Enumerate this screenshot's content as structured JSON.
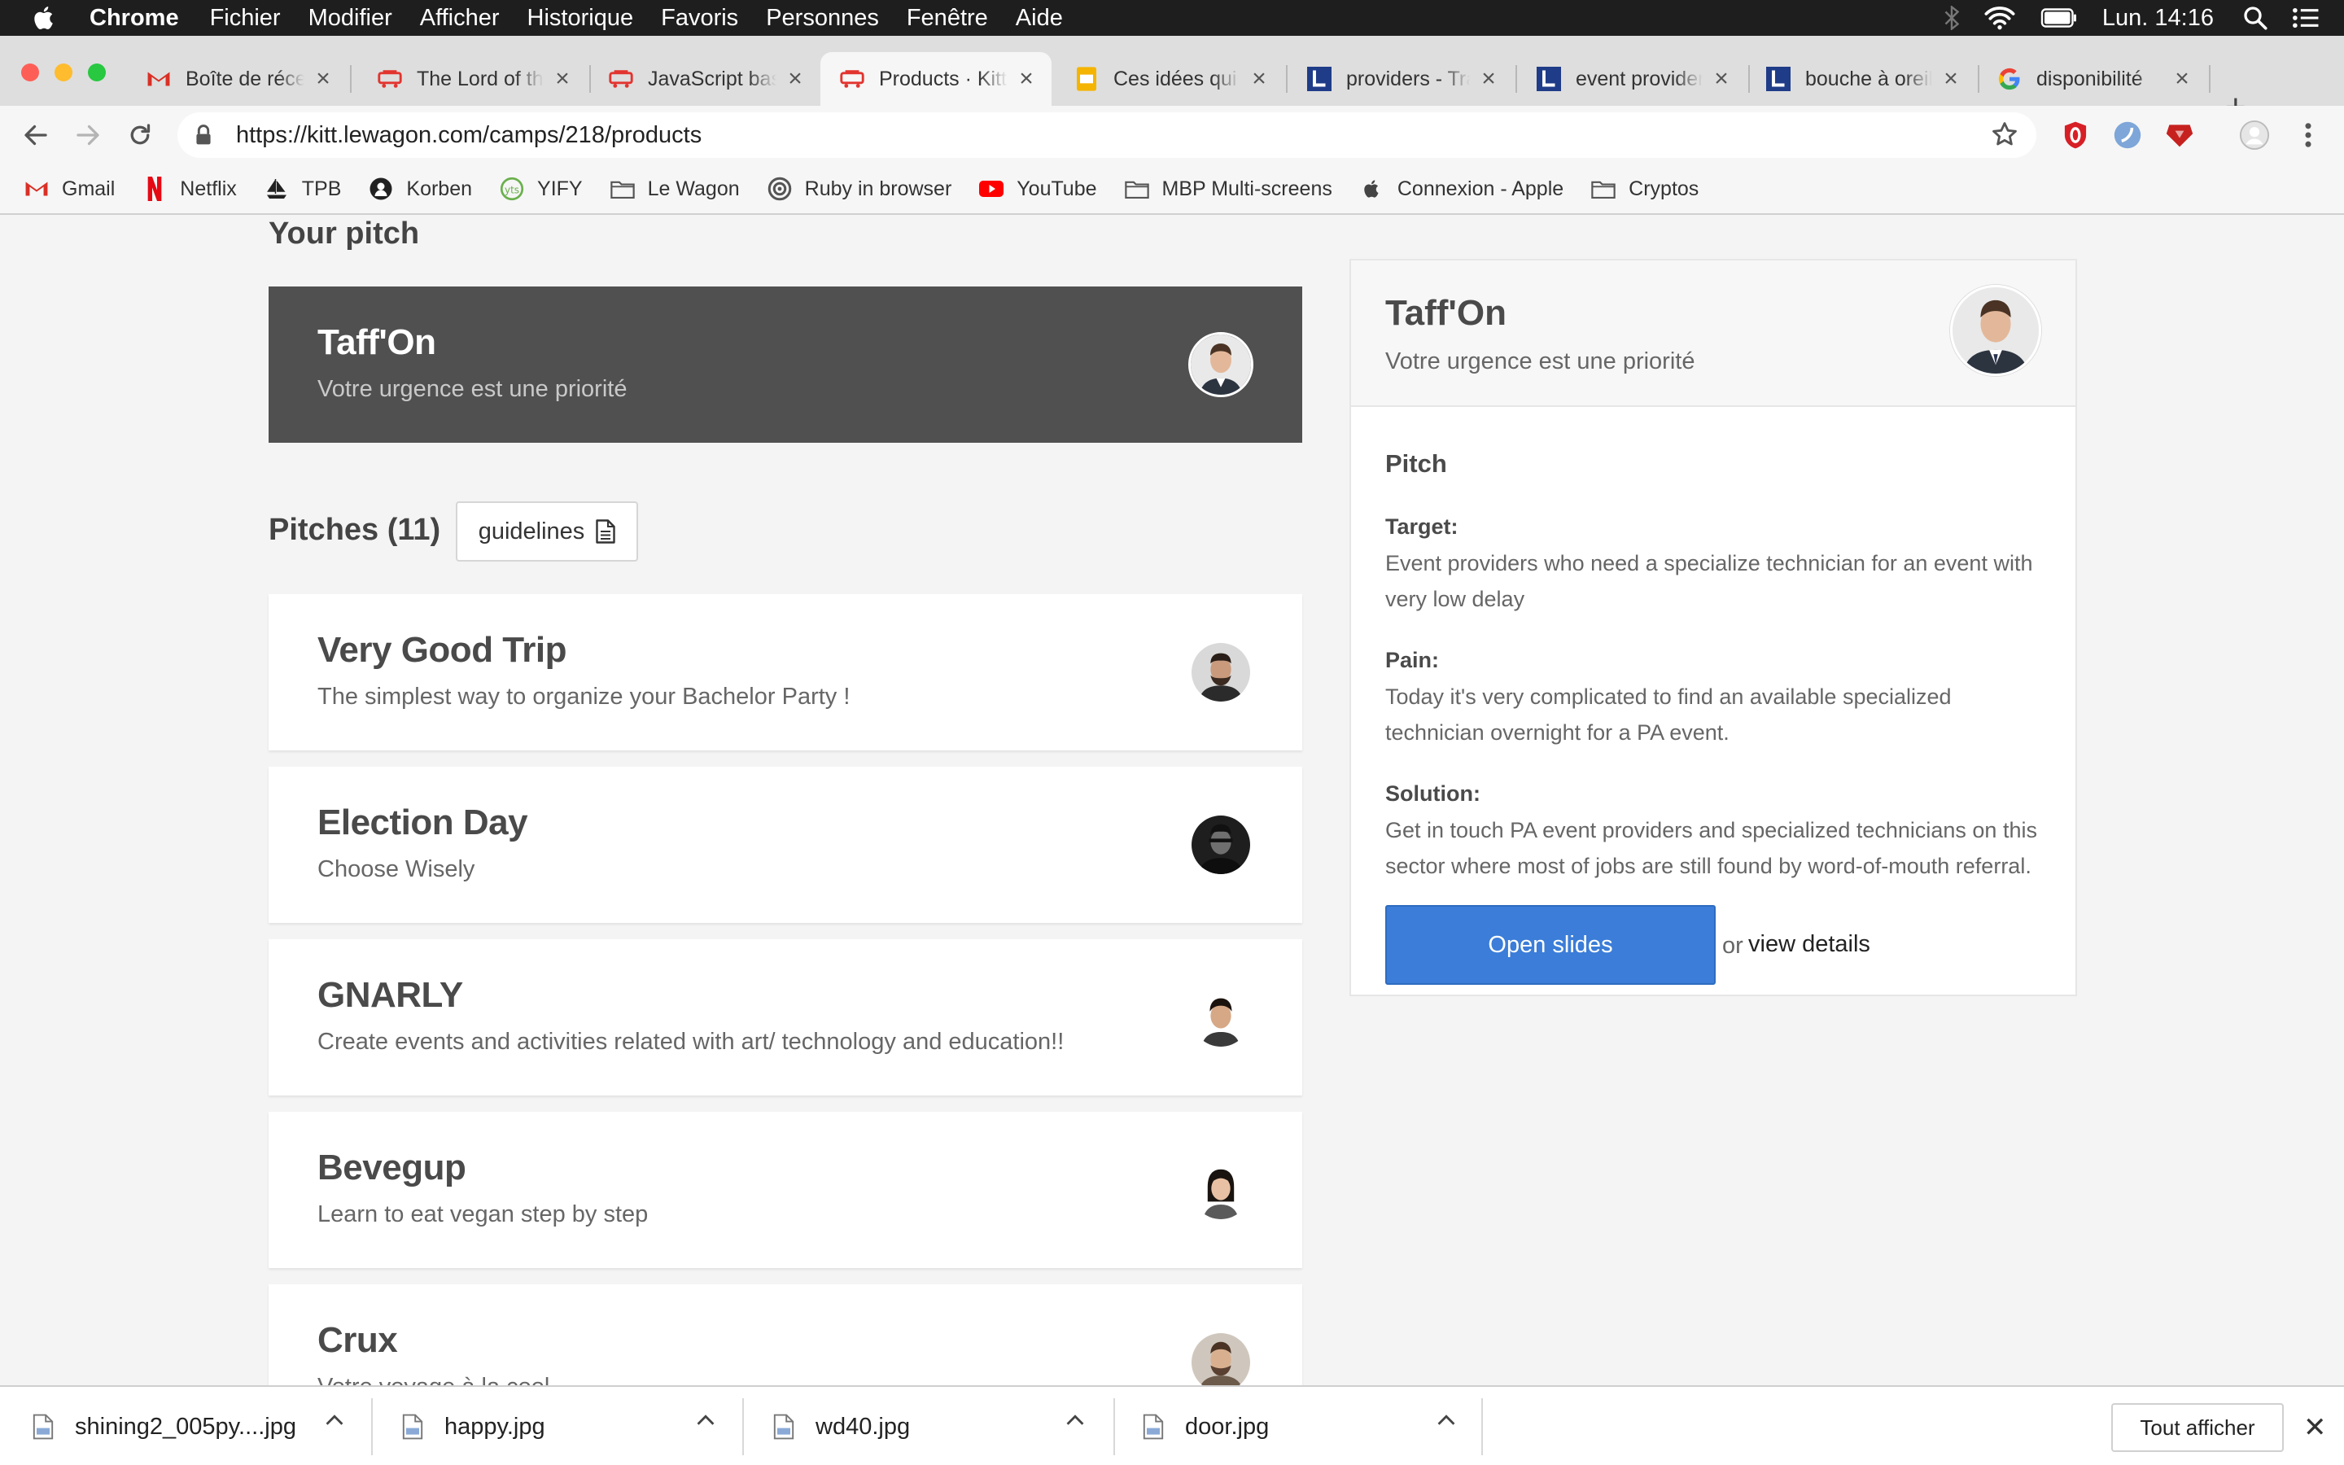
{
  "menubar": {
    "app": "Chrome",
    "items": [
      "Fichier",
      "Modifier",
      "Afficher",
      "Historique",
      "Favoris",
      "Personnes",
      "Fenêtre",
      "Aide"
    ],
    "clock": "Lun. 14:16"
  },
  "tabs": [
    {
      "title": "Boîte de réception",
      "favicon": "gmail-icon"
    },
    {
      "title": "The Lord of the Rings",
      "favicon": "lewagon-icon"
    },
    {
      "title": "JavaScript basics",
      "favicon": "lewagon-icon"
    },
    {
      "title": "Products · Kitt",
      "favicon": "lewagon-icon",
      "active": true
    },
    {
      "title": "Ces idées qui",
      "favicon": "slides-icon"
    },
    {
      "title": "providers - Traduction",
      "favicon": "linguee-icon"
    },
    {
      "title": "event providers",
      "favicon": "linguee-icon"
    },
    {
      "title": "bouche à oreille",
      "favicon": "linguee-icon"
    },
    {
      "title": "disponibilité",
      "favicon": "google-icon"
    }
  ],
  "toolbar": {
    "url": "https://kitt.lewagon.com/camps/218/products"
  },
  "bookmarks": [
    {
      "label": "Gmail",
      "icon": "gmail-icon"
    },
    {
      "label": "Netflix",
      "icon": "netflix-icon"
    },
    {
      "label": "TPB",
      "icon": "ship-icon"
    },
    {
      "label": "Korben",
      "icon": "korben-icon"
    },
    {
      "label": "YIFY",
      "icon": "yify-icon"
    },
    {
      "label": "Le Wagon",
      "icon": "folder-icon"
    },
    {
      "label": "Ruby in browser",
      "icon": "ruby-icon"
    },
    {
      "label": "YouTube",
      "icon": "youtube-icon"
    },
    {
      "label": "MBP Multi-screens",
      "icon": "folder-icon"
    },
    {
      "label": "Connexion - Apple",
      "icon": "apple-icon"
    },
    {
      "label": "Cryptos",
      "icon": "folder-icon"
    }
  ],
  "page": {
    "your_pitch_heading": "Your pitch",
    "my_pitch": {
      "title": "Taff'On",
      "subtitle": "Votre urgence est une priorité"
    },
    "pitches_heading": "Pitches (11)",
    "guidelines_label": "guidelines",
    "pitches": [
      {
        "title": "Very Good Trip",
        "subtitle": "The simplest way to organize your Bachelor Party !"
      },
      {
        "title": "Election Day",
        "subtitle": "Choose Wisely"
      },
      {
        "title": "GNARLY",
        "subtitle": "Create events and activities related with art/ technology and education!!"
      },
      {
        "title": "Bevegup",
        "subtitle": "Learn to eat vegan step by step"
      },
      {
        "title": "Crux",
        "subtitle": "Votre voyage à la cool"
      }
    ],
    "detail": {
      "title": "Taff'On",
      "subtitle": "Votre urgence est une priorité",
      "pitch_heading": "Pitch",
      "target_label": "Target:",
      "target_text": "Event providers who need a specialize technician for an event with very low delay",
      "pain_label": "Pain:",
      "pain_text": "Today it's very complicated to find an available specialized technician overnight for a PA event.",
      "solution_label": "Solution:",
      "solution_text": "Get in touch PA event providers and specialized technicians on this sector where most of jobs are still found by word-of-mouth referral.",
      "open_slides_label": "Open slides",
      "or_label": "or",
      "view_details_label": "view details"
    }
  },
  "downloads": {
    "files": [
      "shining2_005py....jpg",
      "happy.jpg",
      "wd40.jpg",
      "door.jpg"
    ],
    "show_all_label": "Tout afficher"
  },
  "colors": {
    "dark_card": "#505050",
    "primary_button": "#3b7dd8",
    "page_background": "#f4f4f4"
  }
}
